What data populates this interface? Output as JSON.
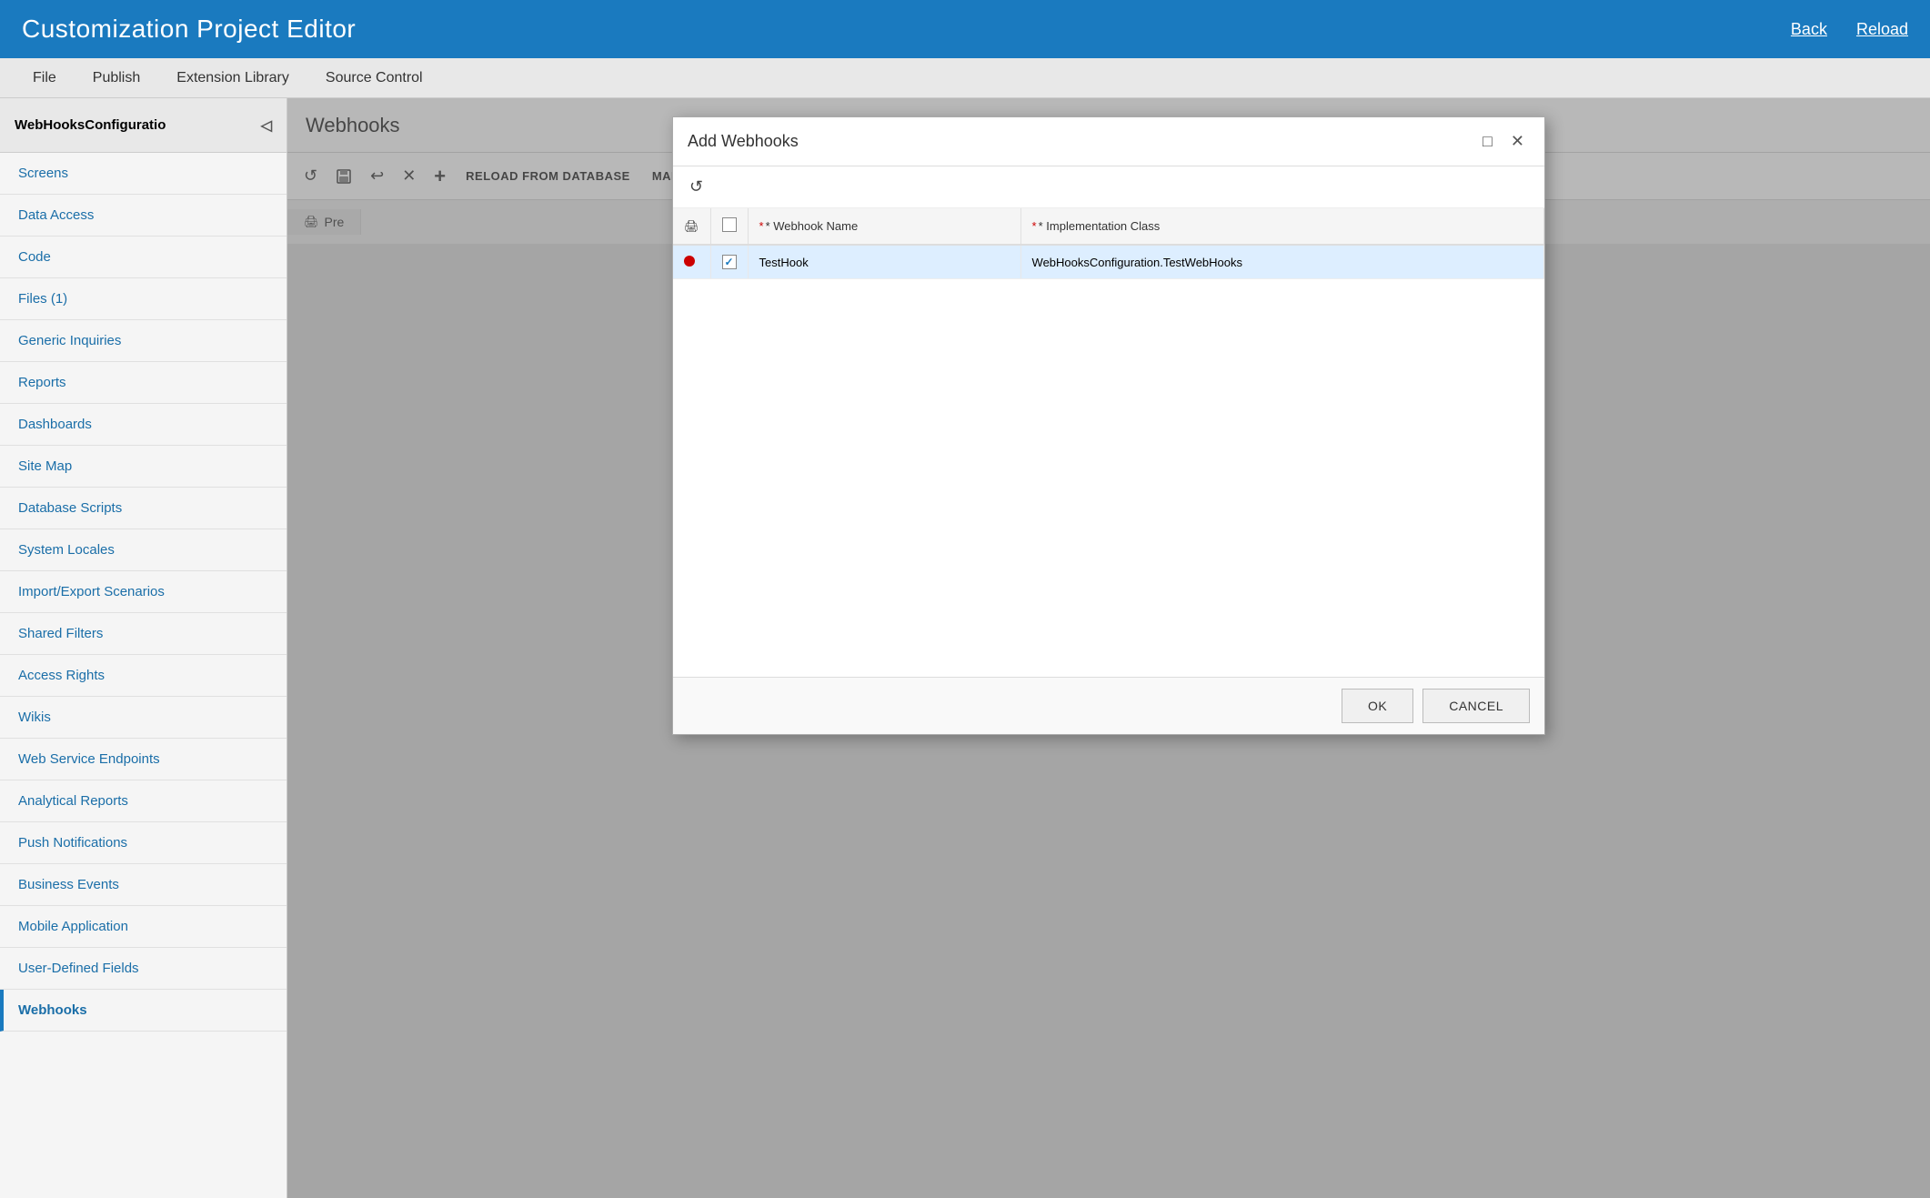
{
  "header": {
    "title": "Customization Project Editor",
    "back_label": "Back",
    "reload_label": "Reload"
  },
  "menu": {
    "items": [
      {
        "label": "File"
      },
      {
        "label": "Publish"
      },
      {
        "label": "Extension Library"
      },
      {
        "label": "Source Control"
      }
    ]
  },
  "sidebar": {
    "project_name": "WebHooksConfiguratio",
    "toggle_icon": "◁",
    "items": [
      {
        "label": "Screens"
      },
      {
        "label": "Data Access"
      },
      {
        "label": "Code"
      },
      {
        "label": "Files (1)"
      },
      {
        "label": "Generic Inquiries"
      },
      {
        "label": "Reports"
      },
      {
        "label": "Dashboards"
      },
      {
        "label": "Site Map"
      },
      {
        "label": "Database Scripts"
      },
      {
        "label": "System Locales"
      },
      {
        "label": "Import/Export Scenarios"
      },
      {
        "label": "Shared Filters"
      },
      {
        "label": "Access Rights"
      },
      {
        "label": "Wikis"
      },
      {
        "label": "Web Service Endpoints"
      },
      {
        "label": "Analytical Reports"
      },
      {
        "label": "Push Notifications"
      },
      {
        "label": "Business Events"
      },
      {
        "label": "Mobile Application"
      },
      {
        "label": "User-Defined Fields"
      },
      {
        "label": "Webhooks",
        "active": true
      }
    ]
  },
  "content": {
    "title": "Webhooks",
    "toolbar": {
      "reload_btn": "↺",
      "save_btn": "💾",
      "undo_btn": "↩",
      "close_btn": "✕",
      "add_btn": "+",
      "reload_db_label": "RELOAD FROM DATABASE",
      "manage_label": "MANAGE WEBHOOKS"
    },
    "pre_tab": "Pre",
    "pre_tab_icon": "🖨"
  },
  "dialog": {
    "title": "Add Webhooks",
    "minimize_icon": "□",
    "close_icon": "✕",
    "refresh_icon": "↺",
    "columns": [
      {
        "label": "* Webhook Name",
        "required": true
      },
      {
        "label": "* Implementation Class",
        "required": true
      }
    ],
    "rows": [
      {
        "status": "modified",
        "checked": true,
        "webhook_name": "TestHook",
        "implementation_class": "WebHooksConfiguration.TestWebHooks"
      }
    ],
    "footer": {
      "ok_label": "OK",
      "cancel_label": "CANCEL"
    }
  },
  "colors": {
    "header_bg": "#1a7abf",
    "accent": "#1a6ea8",
    "required_star": "#cc0000",
    "modified_dot": "#cc0000"
  }
}
